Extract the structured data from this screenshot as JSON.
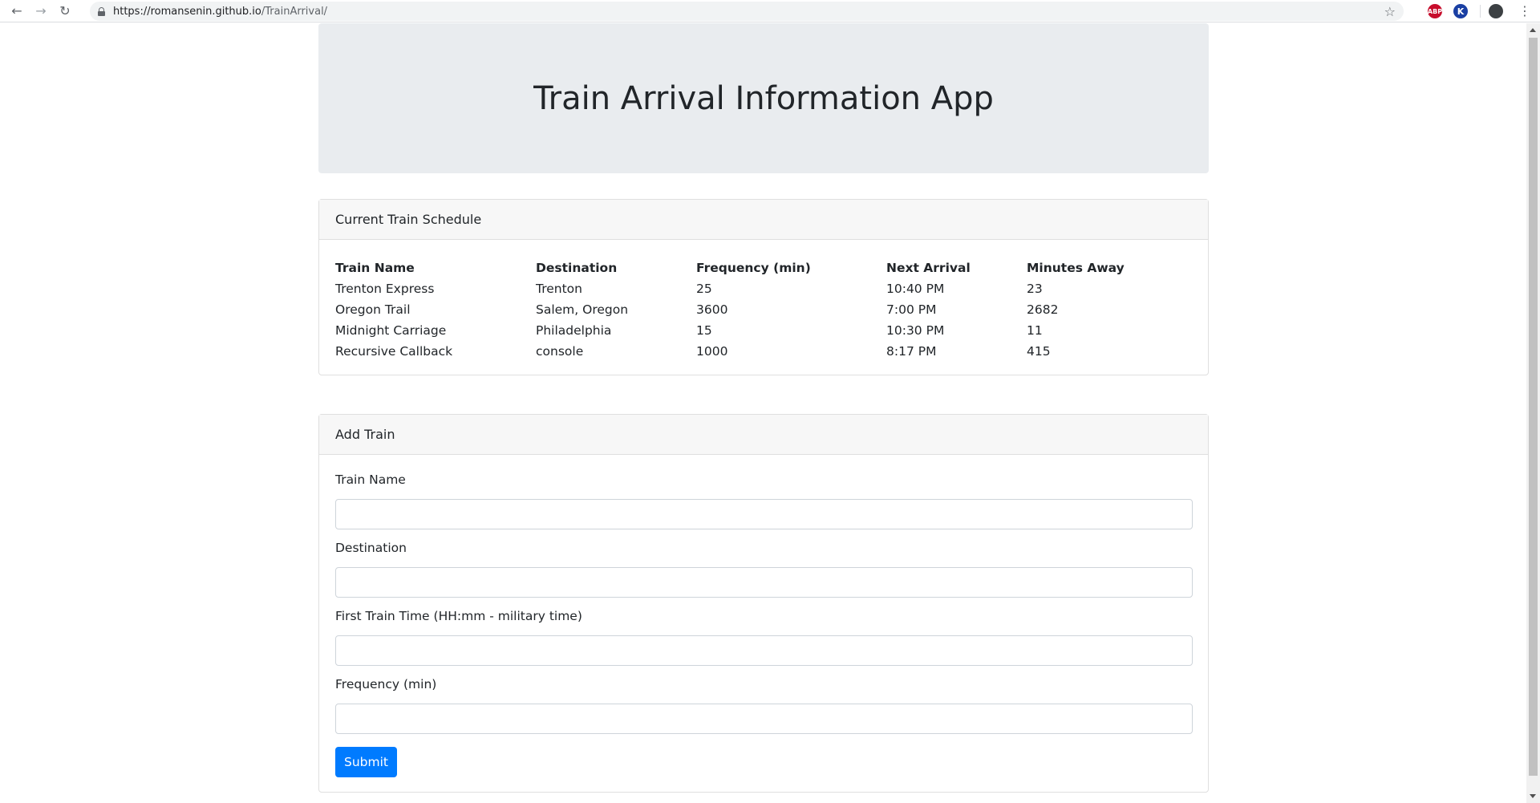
{
  "browser": {
    "url_host": "https://romansenin.github.io",
    "url_path": "/TrainArrival/",
    "ext_abp": "ABP",
    "ext_k": "K"
  },
  "page": {
    "title": "Train Arrival Information App"
  },
  "schedule": {
    "header": "Current Train Schedule",
    "columns": [
      "Train Name",
      "Destination",
      "Frequency (min)",
      "Next Arrival",
      "Minutes Away"
    ],
    "rows": [
      [
        "Trenton Express",
        "Trenton",
        "25",
        "10:40 PM",
        "23"
      ],
      [
        "Oregon Trail",
        "Salem, Oregon",
        "3600",
        "7:00 PM",
        "2682"
      ],
      [
        "Midnight Carriage",
        "Philadelphia",
        "15",
        "10:30 PM",
        "11"
      ],
      [
        "Recursive Callback",
        "console",
        "1000",
        "8:17 PM",
        "415"
      ]
    ]
  },
  "form": {
    "header": "Add Train",
    "train_name_label": "Train Name",
    "destination_label": "Destination",
    "first_time_label": "First Train Time (HH:mm - military time)",
    "frequency_label": "Frequency (min)",
    "submit_label": "Submit"
  }
}
